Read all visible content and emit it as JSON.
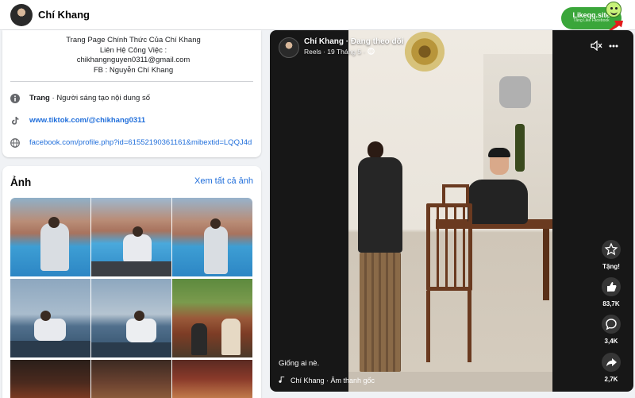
{
  "header": {
    "page_name": "Chí Khang",
    "likeqq_badge": "Likeqq.site",
    "likeqq_sub": "Tăng Like Facebook"
  },
  "intro": {
    "bio_lines": [
      "Trang Page Chính Thức Của Chí Khang",
      "Liên Hệ Công Việc :",
      "chikhangnguyen0311@gmail.com",
      "FB : Nguyễn Chí Khang"
    ],
    "category_label": "Trang",
    "category_value": " · Người sáng tạo nội dung số",
    "tiktok_link": "www.tiktok.com/@chikhang0311",
    "facebook_link": "facebook.com/profile.php?id=61552190361161&mibextid=LQQJ4d"
  },
  "photos": {
    "title": "Ảnh",
    "see_all": "Xem tất cả ảnh"
  },
  "video": {
    "author": "Chí Khang",
    "follow_status": " · Đang theo dõi",
    "meta": "Reels · 19 Tháng 5 ·",
    "caption": "Giống ai nè.",
    "audio": "Chí Khang · Âm thanh gốc",
    "gift_label": "Tặng!",
    "like_count": "83,7K",
    "comment_count": "3,4K",
    "share_count": "2,7K"
  },
  "icons": {
    "info": "info-icon",
    "tiktok": "tiktok-icon",
    "globe": "globe-icon",
    "mute": "speaker-muted-icon",
    "more": "more-icon",
    "gift": "gift-star-icon",
    "like": "thumbs-up-icon",
    "comment": "comment-icon",
    "share": "share-icon",
    "music": "music-note-icon"
  },
  "colors": {
    "link": "#216fdb",
    "likeqq_green": "#3aa63a",
    "video_bg": "#171717"
  }
}
